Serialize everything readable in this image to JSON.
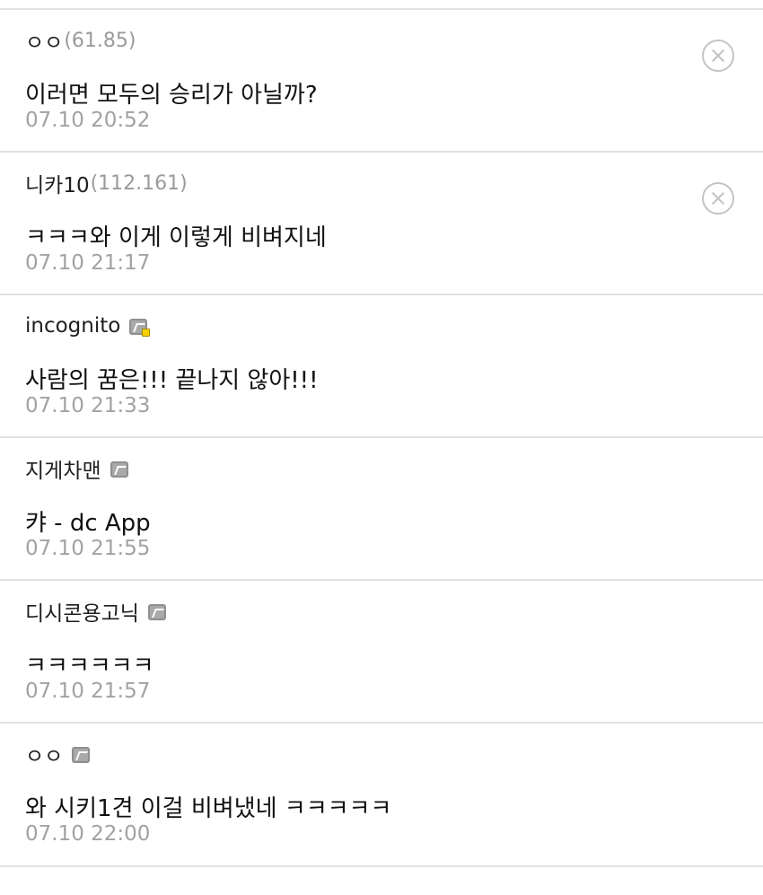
{
  "comments": [
    {
      "nickname": "ㅇㅇ",
      "ip": "(61.85)",
      "content": "이러면 모두의 승리가 아닐까?",
      "timestamp": "07.10 20:52",
      "has_delete": true,
      "gallog_icon": "none"
    },
    {
      "nickname": "니카10",
      "ip": "(112.161)",
      "content": "ㅋㅋㅋ와 이게 이렇게 비벼지네",
      "timestamp": "07.10 21:17",
      "has_delete": true,
      "gallog_icon": "none"
    },
    {
      "nickname": "incognito",
      "ip": "",
      "content": "사람의 꿈은!!! 끝나지 않아!!!",
      "timestamp": "07.10 21:33",
      "has_delete": false,
      "gallog_icon": "fixed-nick-sub-manager-icon"
    },
    {
      "nickname": "지게차맨",
      "ip": "",
      "content": "캬 - dc App",
      "timestamp": "07.10 21:55",
      "has_delete": false,
      "gallog_icon": "fixed-nick-icon"
    },
    {
      "nickname": "디시콘용고닉",
      "ip": "",
      "content": "ㅋㅋㅋㅋㅋㅋ",
      "timestamp": "07.10 21:57",
      "has_delete": false,
      "gallog_icon": "fixed-nick-icon"
    },
    {
      "nickname": "ㅇㅇ",
      "ip": "",
      "content": "와 시키1견 이걸 비벼냈네 ㅋㅋㅋㅋㅋ",
      "timestamp": "07.10 22:00",
      "has_delete": false,
      "gallog_icon": "fixed-nick-icon"
    }
  ],
  "colors": {
    "divider": "#e2e2e2",
    "timestamp": "#a2a2a2",
    "ip": "#9a9a9a",
    "sub_manager_badge": "#f6d200"
  }
}
